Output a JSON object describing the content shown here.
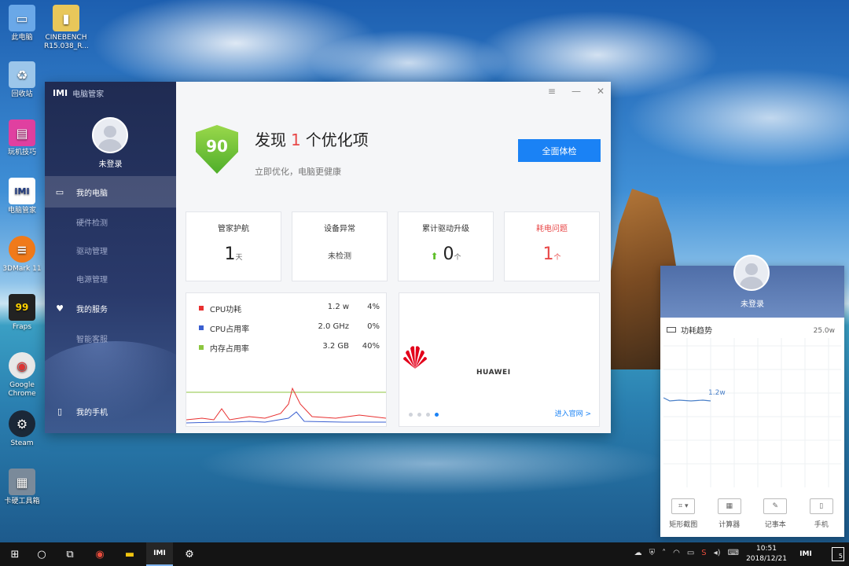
{
  "desktop": {
    "icons": [
      {
        "label": "此电脑",
        "glyph": "▭",
        "bg": "#6aa8e8"
      },
      {
        "label": "CINEBENCH R15.038_R...",
        "glyph": "▮",
        "bg": "#e8c75a"
      },
      {
        "label": "回收站",
        "glyph": "♻",
        "bg": "#9cc6ea"
      },
      {
        "label": "玩机技巧",
        "glyph": "▤",
        "bg": "#e040a0"
      },
      {
        "label": "电脑管家",
        "glyph": "IMI",
        "bg": "#ffffff"
      },
      {
        "label": "3DMark 11",
        "glyph": "≡",
        "bg": "#f07a1a"
      },
      {
        "label": "Fraps",
        "glyph": "99",
        "bg": "#222222"
      },
      {
        "label": "Google Chrome",
        "glyph": "◉",
        "bg": "#e8e8e8"
      },
      {
        "label": "Steam",
        "glyph": "⚙",
        "bg": "#1b2838"
      },
      {
        "label": "卡硬工具箱",
        "glyph": "▦",
        "bg": "#7a8a9a"
      }
    ]
  },
  "app": {
    "title": "电脑管家",
    "logo": "IMI",
    "user": {
      "status": "未登录"
    },
    "nav": {
      "my_pc": "我的电脑",
      "hardware": "硬件检测",
      "driver": "驱动管理",
      "power": "电源管理",
      "my_service": "我的服务",
      "support": "智能客服",
      "my_phone": "我的手机"
    },
    "score": "90",
    "headline": {
      "prefix": "发现",
      "count": "1",
      "suffix": "个优化项"
    },
    "subhead": "立即优化，电脑更健康",
    "scan_button": "全面体检",
    "cards": [
      {
        "title": "管家护航",
        "value": "1",
        "unit": "天"
      },
      {
        "title": "设备异常",
        "value": "未检测",
        "unit": ""
      },
      {
        "title": "累计驱动升级",
        "value": "0",
        "unit": "个"
      },
      {
        "title": "耗电问题",
        "value": "1",
        "unit": "个"
      }
    ],
    "metrics": [
      {
        "name": "CPU功耗",
        "v1": "1.2 w",
        "v2": "4%",
        "color": "#e83030"
      },
      {
        "name": "CPU占用率",
        "v1": "2.0 GHz",
        "v2": "0%",
        "color": "#3a5fd0"
      },
      {
        "name": "内存占用率",
        "v1": "3.2 GB",
        "v2": "40%",
        "color": "#8cc63f"
      }
    ],
    "ad": {
      "brand": "HUAWEI",
      "link": "进入官网 >"
    }
  },
  "widget": {
    "user_status": "未登录",
    "power_title": "功耗趋势",
    "power_max": "25.0w",
    "power_current": "1.2w",
    "tools": [
      "矩形截图",
      "计算器",
      "记事本",
      "手机"
    ]
  },
  "taskbar": {
    "time": "10:51",
    "date": "2018/12/21",
    "notifications": "5"
  }
}
